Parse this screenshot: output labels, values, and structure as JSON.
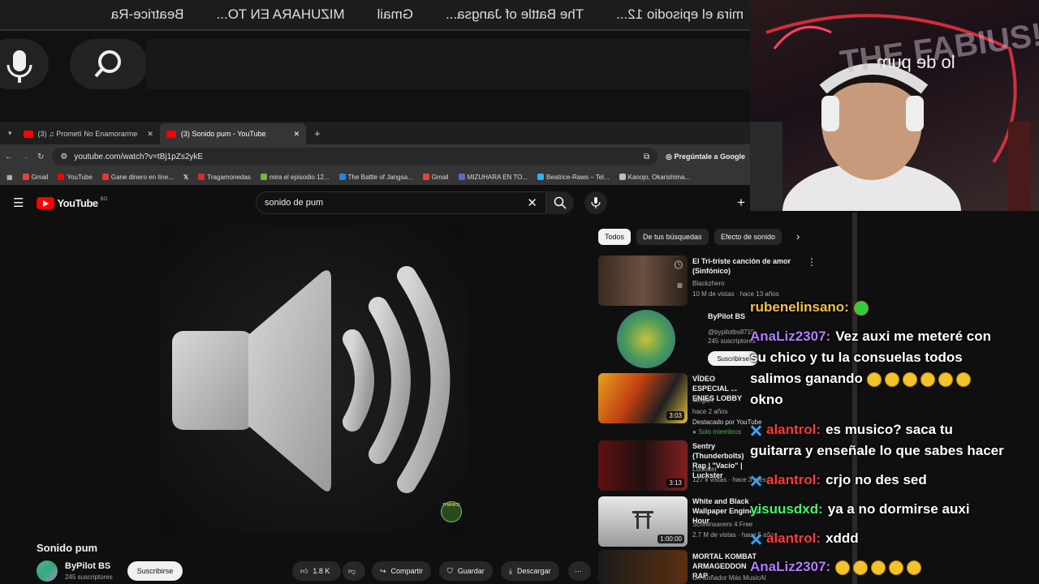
{
  "mirror": {
    "tabs": [
      "Beatrice-Ra",
      "MIZUHARA EN TO...",
      "Gmail",
      "The Battle of Jangsa...",
      "mira el episodio 12..."
    ],
    "search_text": "lo de pum"
  },
  "chrome": {
    "tabs": [
      {
        "label": "(3) ♫ Prometí No Enamorarme"
      },
      {
        "label": "(3) Sonido pum - YouTube"
      }
    ],
    "url": "youtube.com/watch?v=tBj1pZs2ykE",
    "ask_google": "Pregúntale a Google",
    "bookmarks": [
      {
        "label": "Gmail",
        "color": "#ea4335"
      },
      {
        "label": "YouTube",
        "color": "#ff0000"
      },
      {
        "label": "Gane dinero en líne...",
        "color": "#e53935"
      },
      {
        "label": "",
        "color": "#ffffff"
      },
      {
        "label": "Tragamonedas",
        "color": "#d32f2f"
      },
      {
        "label": "mira el episodio 12...",
        "color": "#7cb342"
      },
      {
        "label": "The Battle of Jangsa...",
        "color": "#1e88e5"
      },
      {
        "label": "Gmail",
        "color": "#ea4335"
      },
      {
        "label": "MIZUHARA EN TO...",
        "color": "#5c6bc0"
      },
      {
        "label": "Beatrice-Raws – Tel...",
        "color": "#29b6f6"
      },
      {
        "label": "Kanojo, Okarishima...",
        "color": "#bdbdbd"
      }
    ]
  },
  "youtube": {
    "logo": "YouTube",
    "logo_sup": "BO",
    "search": "sonido de pum",
    "video_title": "Sonido pum",
    "channel": "ByPilot BS",
    "subs": "245 suscriptores",
    "subscribe": "Suscribirse",
    "likes": "1.8 K",
    "share": "Compartir",
    "save": "Guardar",
    "download": "Descargar",
    "watermark": "THANKS!",
    "chips": [
      "Todos",
      "De tus búsquedas",
      "Efecto de sonido"
    ],
    "sidebar": [
      {
        "title": "El Tri-triste canción de amor (Sinfónico)",
        "channel": "Blackzhero",
        "meta": "10 M de vistas · hace 13 años",
        "duration": ""
      },
      {
        "title": "ByPilot BS",
        "channel": "@bypilotbs8715",
        "meta": "245 suscriptores",
        "duration": "",
        "button": "Suscribirse"
      },
      {
        "title": "VÍDEO ESPECIAL ... ENIES LOBBY",
        "channel": "MegaR",
        "meta": "hace 2 años",
        "badge": "Destacado por YouTube",
        "badge2": "Solo miembros",
        "duration": "3:03"
      },
      {
        "title": "Sentry (Thunderbolts) Rap | \"Vacío\" | Luckster",
        "channel": "Luckster",
        "meta": "127 k vistas · hace 3 meses",
        "duration": "3:13"
      },
      {
        "title": "White and Black Wallpaper Engine 1 Hour",
        "channel": "Screensavers 4 Free",
        "meta": "2.7 M de vistas · hace 5 años",
        "duration": "1:00:00"
      },
      {
        "title": "MORTAL KOMBAT ARMAGEDDON RAP",
        "channel": "Un Soñador Más MusicAl",
        "meta": "",
        "duration": ""
      }
    ]
  },
  "webcam": {
    "sign_text": "THE FABIUS!"
  },
  "chat": [
    {
      "user": "rubenelinsano:",
      "color": "#f5c242",
      "text": ""
    },
    {
      "user": "AnaLiz2307:",
      "color": "#b47cff",
      "text": "Vez auxi me meteré con"
    },
    {
      "user": "",
      "color": "#ffffff",
      "text": "su chico y tu la consuelas todos"
    },
    {
      "user": "",
      "color": "#ffffff",
      "text": "salimos ganando"
    },
    {
      "user": "",
      "color": "#ffffff",
      "text": "okno"
    },
    {
      "user": "alantrol:",
      "color": "#ff3b3b",
      "text": "es musico? saca tu"
    },
    {
      "user": "",
      "color": "#ffffff",
      "text": "guitarra y enseñale lo que sabes hacer"
    },
    {
      "user": "alantrol:",
      "color": "#ff3b3b",
      "text": "crjo no des sed"
    },
    {
      "user": "yisuusdxd:",
      "color": "#3cff6b",
      "text": "ya a no dormirse auxi"
    },
    {
      "user": "alantrol:",
      "color": "#ff3b3b",
      "text": "xddd"
    },
    {
      "user": "AnaLiz2307:",
      "color": "#b47cff",
      "text": ""
    }
  ]
}
